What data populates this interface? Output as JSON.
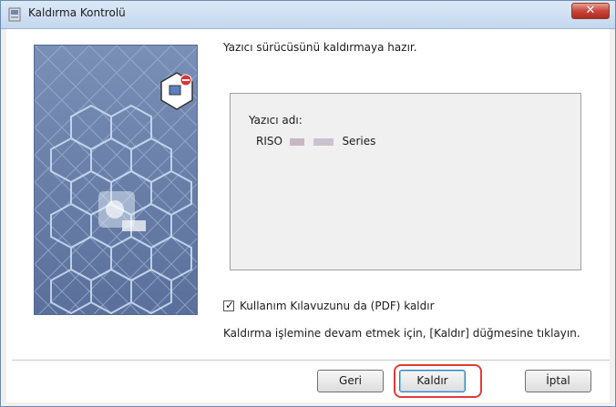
{
  "window": {
    "title": "Kaldırma Kontrolü",
    "close_label": "✕"
  },
  "main": {
    "instruction": "Yazıcı sürücüsünü kaldırmaya hazır.",
    "printer_label": "Yazıcı adı:",
    "printer_brand": "RISO",
    "printer_series": "Series",
    "checkbox": {
      "label": "Kullanım Kılavuzunu da (PDF) kaldır",
      "checked": true
    },
    "hint": "Kaldırma işlemine devam etmek için, [Kaldır] düğmesine tıklayın."
  },
  "buttons": {
    "back": "Geri",
    "uninstall": "Kaldır",
    "cancel": "İptal"
  },
  "colors": {
    "highlight": "#e23a3a",
    "art_bg": "#6a80aa",
    "title_bar": "#c4d7ee"
  }
}
